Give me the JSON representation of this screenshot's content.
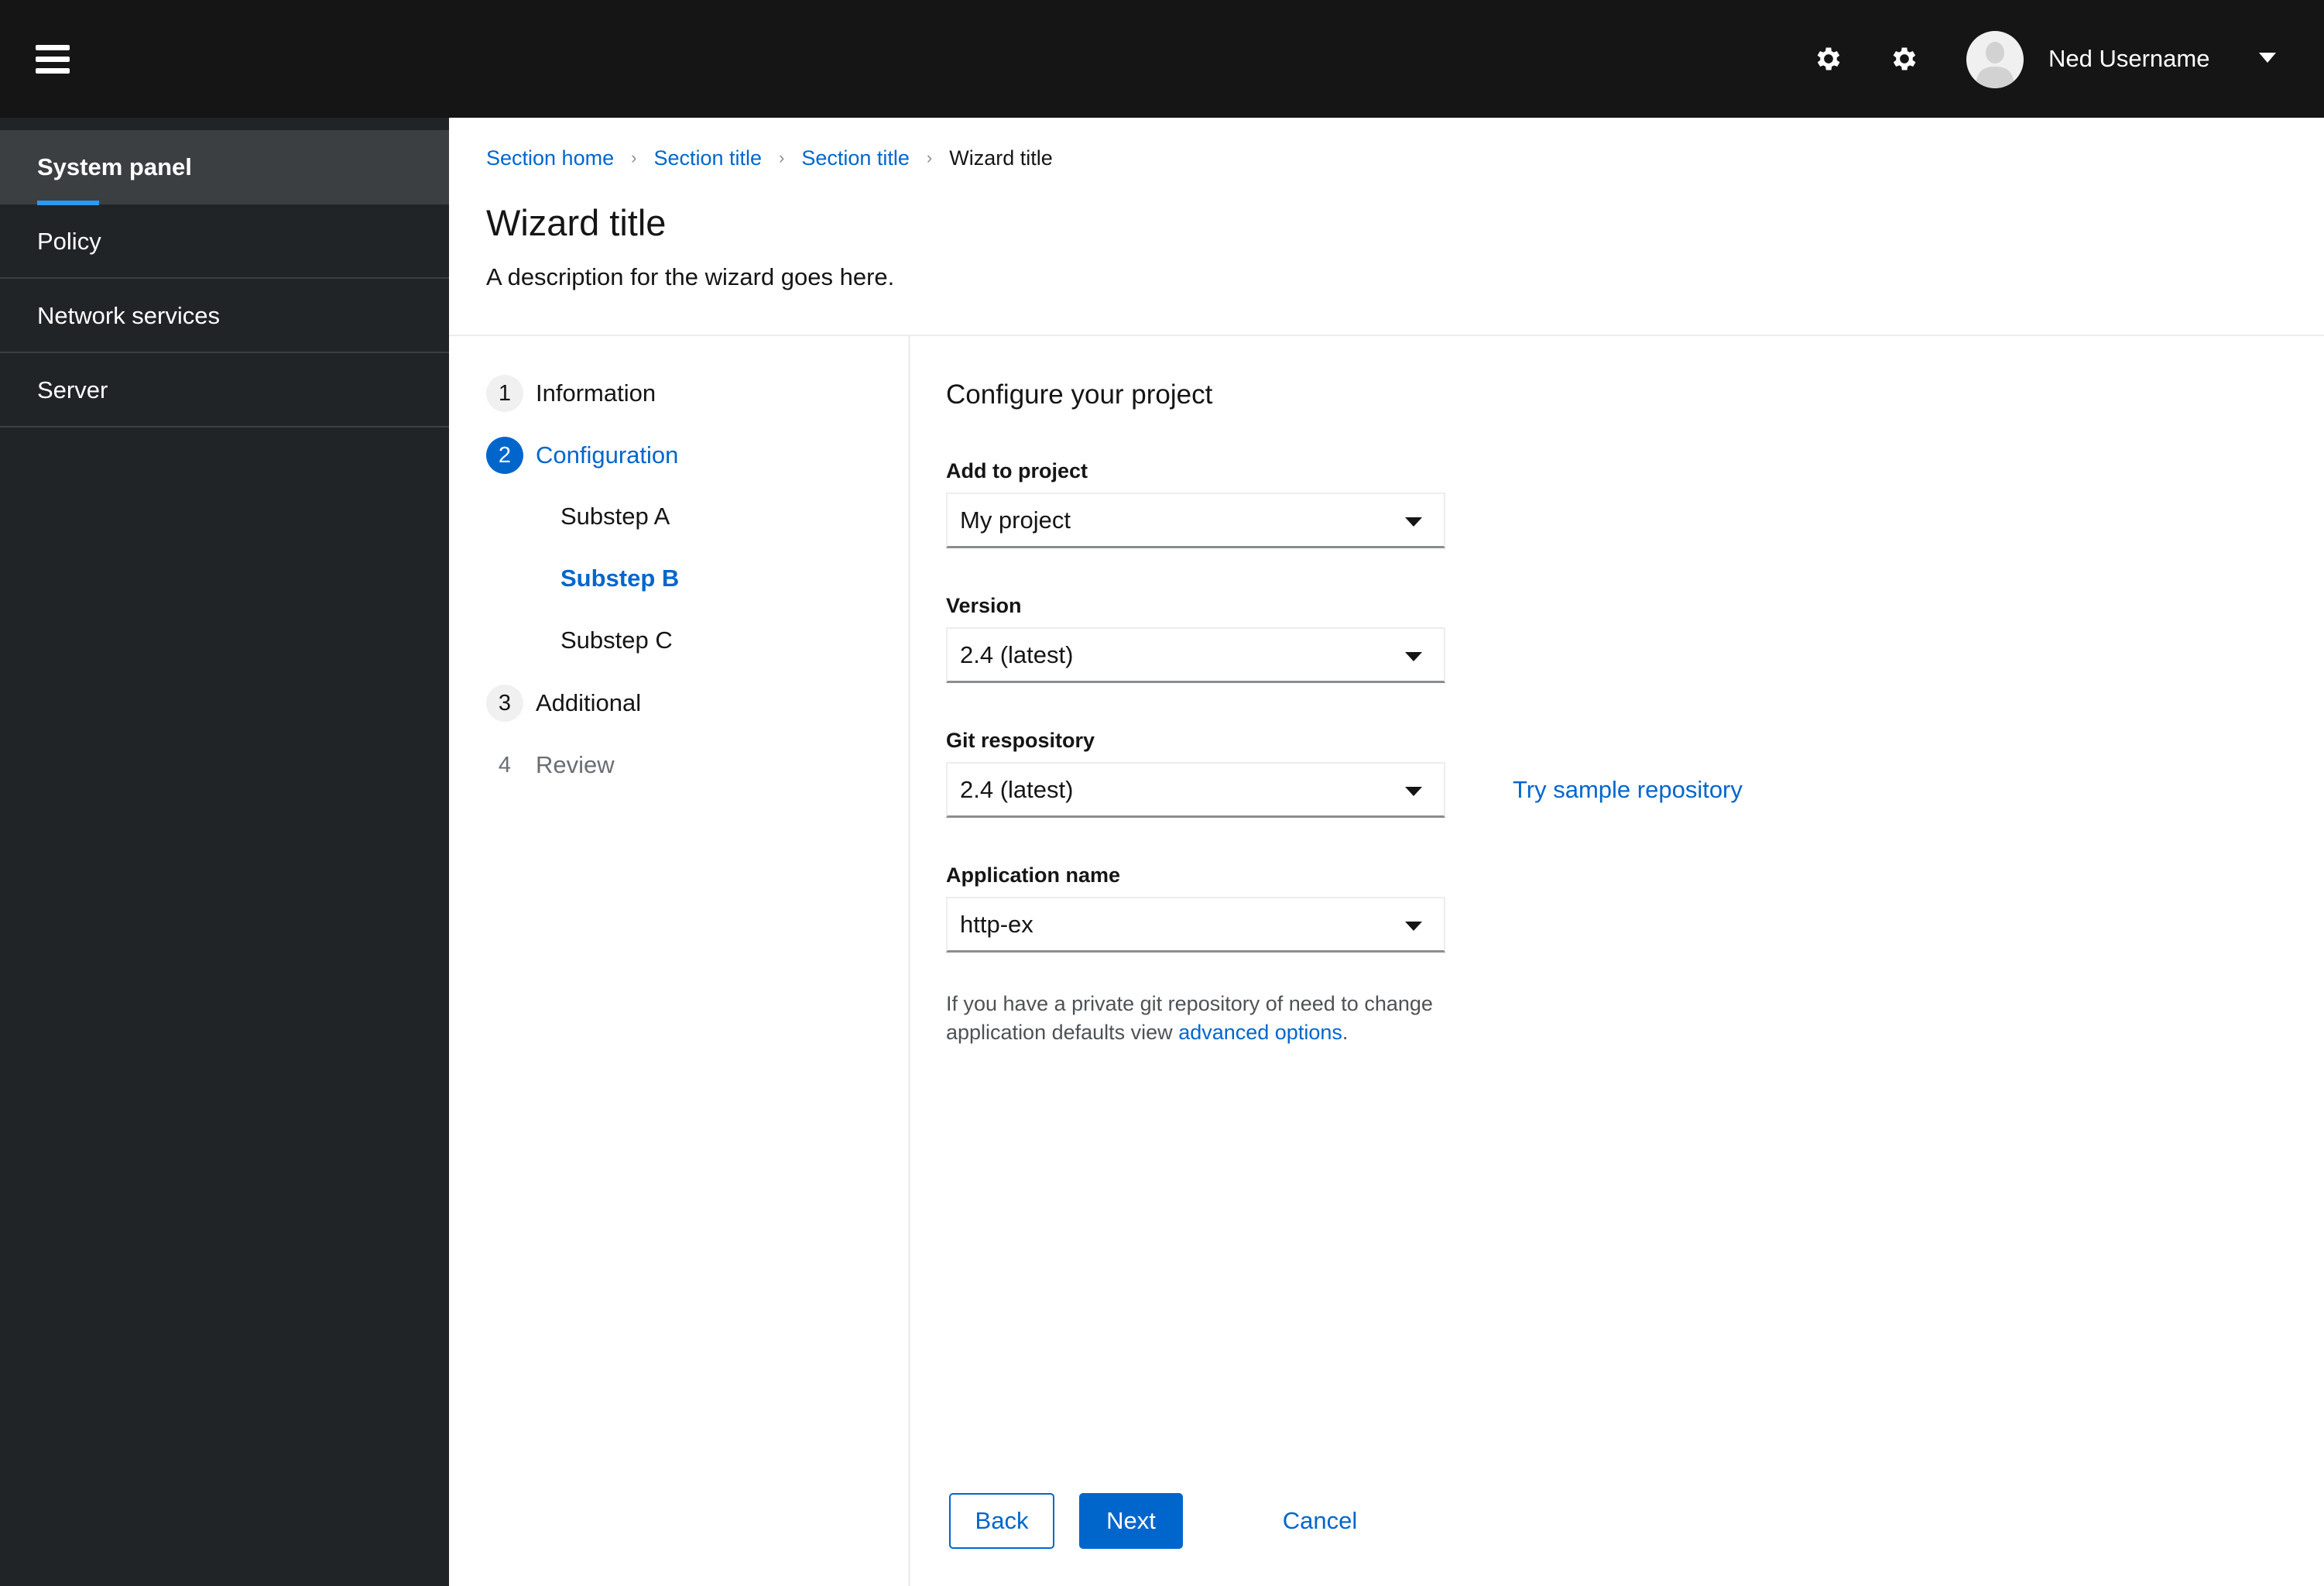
{
  "masthead": {
    "menu_icon": "hamburger-icon",
    "settings_icon_1": "gear-icon",
    "settings_icon_2": "gear-icon",
    "user_name": "Ned Username",
    "user_menu_icon": "caret-down-icon"
  },
  "sidebar": {
    "items": [
      {
        "label": "System panel",
        "active": true
      },
      {
        "label": "Policy",
        "active": false
      },
      {
        "label": "Network services",
        "active": false
      },
      {
        "label": "Server",
        "active": false
      }
    ]
  },
  "breadcrumb": {
    "items": [
      {
        "label": "Section home",
        "link": true
      },
      {
        "label": "Section title",
        "link": true
      },
      {
        "label": "Section title",
        "link": true
      },
      {
        "label": "Wizard title",
        "link": false
      }
    ],
    "separator": "›"
  },
  "page": {
    "title": "Wizard title",
    "description": "A description for the wizard goes here."
  },
  "wizard_nav": {
    "steps": [
      {
        "number": "1",
        "label": "Information",
        "state": "default"
      },
      {
        "number": "2",
        "label": "Configuration",
        "state": "current"
      },
      {
        "number": "3",
        "label": "Additional",
        "state": "default"
      },
      {
        "number": "4",
        "label": "Review",
        "state": "disabled"
      }
    ],
    "substeps": [
      {
        "label": "Substep A",
        "state": "default"
      },
      {
        "label": "Substep B",
        "state": "current"
      },
      {
        "label": "Substep C",
        "state": "default"
      }
    ]
  },
  "form": {
    "title": "Configure your project",
    "fields": [
      {
        "label": "Add to project",
        "value": "My project"
      },
      {
        "label": "Version",
        "value": "2.4 (latest)"
      },
      {
        "label": "Git respository",
        "value": "2.4 (latest)"
      },
      {
        "label": "Application name",
        "value": "http-ex"
      }
    ],
    "sample_link": "Try sample repository",
    "helper_text": "If you have a private git repository of need to change application defaults view ",
    "helper_link": "advanced options",
    "helper_end": "."
  },
  "footer": {
    "back_label": "Back",
    "next_label": "Next",
    "cancel_label": "Cancel"
  },
  "colors": {
    "masthead_bg": "#151515",
    "sidebar_bg": "#212427",
    "sidebar_active_bg": "#3c3f42",
    "accent": "#0066cc",
    "active_indicator": "#2b9af3"
  }
}
